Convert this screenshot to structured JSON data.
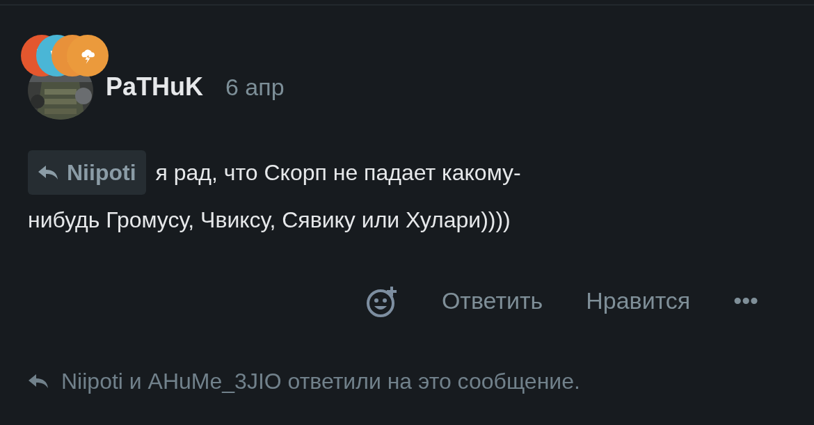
{
  "post": {
    "badges": [
      {
        "color": "#e4572e"
      },
      {
        "color": "#4ab6d6"
      },
      {
        "color": "#e8913a"
      },
      {
        "color": "#eb9a3c"
      }
    ],
    "author": "PaTHuK",
    "date": "6 апр",
    "reply_to": "Niipoti",
    "text_lines": [
      "я рад, что Скорп не падает какому-",
      "нибудь Громусу, Чвиксу, Сявику или Хулари))))"
    ],
    "actions": [
      "Ответить",
      "Нравится",
      "•••"
    ],
    "replies_note": "Niipoti и AHuMe_3JIO ответили на это сообщение."
  }
}
